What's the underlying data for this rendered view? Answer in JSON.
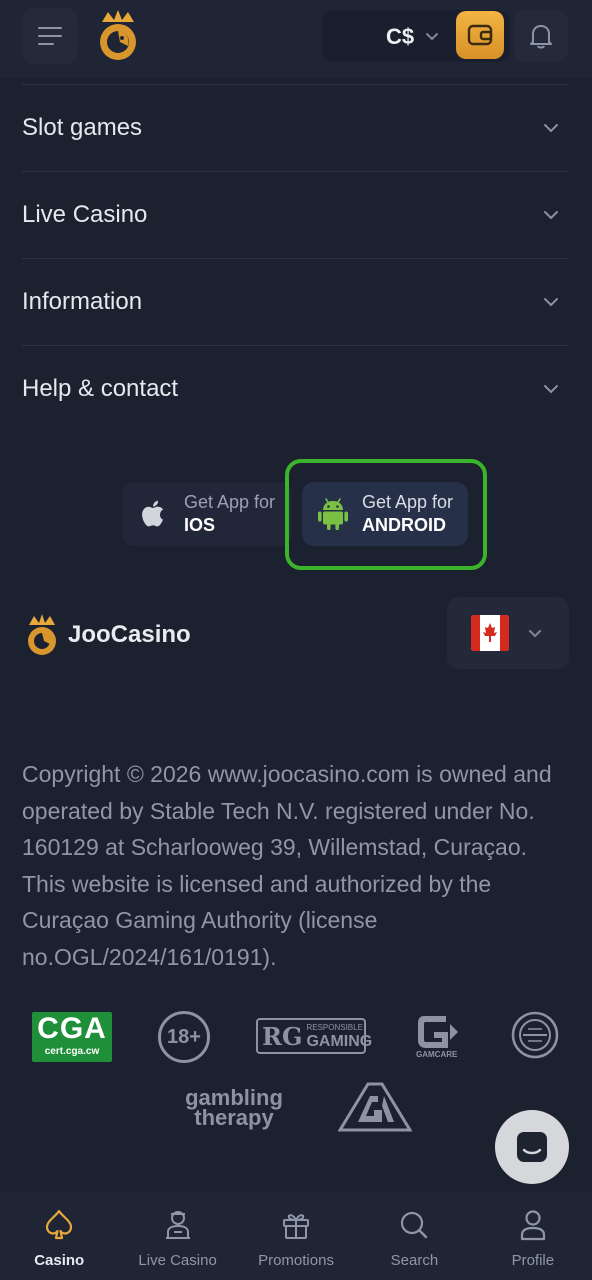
{
  "header": {
    "currency": "C$",
    "icons": [
      "menu-icon",
      "crown-logo-icon",
      "chevron-down-icon",
      "wallet-icon",
      "bell-icon"
    ]
  },
  "accordion": [
    {
      "label": "Slot games"
    },
    {
      "label": "Live Casino"
    },
    {
      "label": "Information"
    },
    {
      "label": "Help & contact"
    }
  ],
  "apps": {
    "ios": {
      "line1": "Get App for",
      "line2": "IOS"
    },
    "android": {
      "line1": "Get App for",
      "line2": "ANDROID"
    }
  },
  "brand": {
    "name": "JooCasino"
  },
  "country": {
    "flag": "canada-flag-icon"
  },
  "copyright": "Copyright © 2026 www.joocasino.com is owned and operated by Stable Tech N.V. registered under No. 160129 at Scharlooweg 39, Willemstad, Curaçao. This website is licensed and authorized by the Curaçao Gaming Authority (license no.OGL/2024/161/0191).",
  "badges": {
    "cga_big": "CGA",
    "cga_small": "cert.cga.cw",
    "age": "18+",
    "rg_mark": "RG",
    "rg_small": "RESPONSIBLE",
    "rg_big": "GAMING",
    "gamcare": "GAMCARE",
    "gt_line1": "gambling",
    "gt_line2": "therapy"
  },
  "bottom_nav": [
    {
      "label": "Casino",
      "active": true
    },
    {
      "label": "Live Casino",
      "active": false
    },
    {
      "label": "Promotions",
      "active": false
    },
    {
      "label": "Search",
      "active": false
    },
    {
      "label": "Profile",
      "active": false
    }
  ],
  "colors": {
    "background": "#1c2130",
    "accent_gold": "#f2b441",
    "highlight_green": "#3bb32a",
    "android_green": "#79c043"
  }
}
